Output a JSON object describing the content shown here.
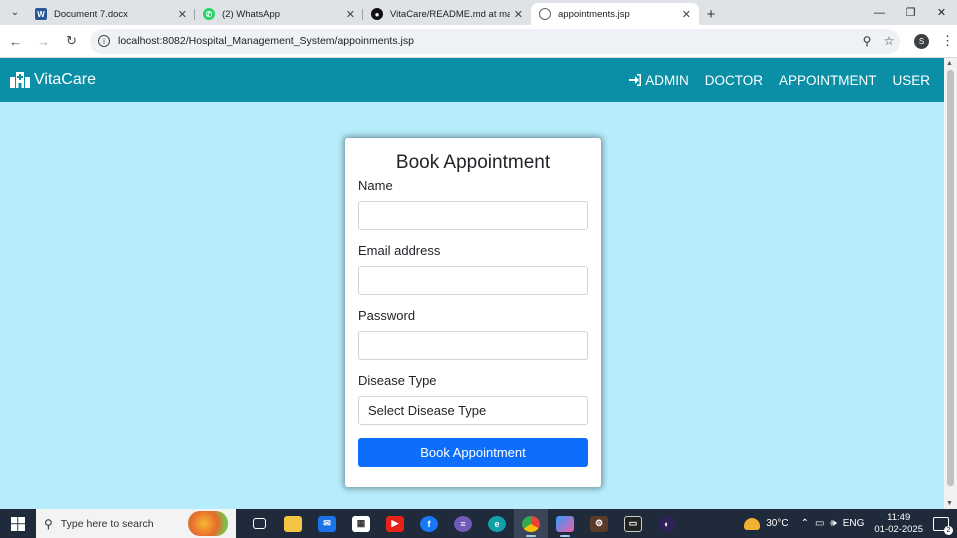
{
  "browser": {
    "tabs": [
      {
        "title": "Document 7.docx",
        "icon": "word-icon",
        "color": "#2b579a",
        "glyph": "W"
      },
      {
        "title": "(2) WhatsApp",
        "icon": "whatsapp-icon",
        "color": "#25d366",
        "glyph": ""
      },
      {
        "title": "VitaCare/README.md at main ·",
        "icon": "github-icon",
        "color": "#111111",
        "glyph": ""
      },
      {
        "title": "appointments.jsp",
        "icon": "globe-icon",
        "color": "#5f6368",
        "glyph": ""
      }
    ],
    "url": "localhost:8082/Hospital_Management_System/appoinments.jsp",
    "profile_initial": "S"
  },
  "navbar": {
    "brand": "VitaCare",
    "links": [
      "ADMIN",
      "DOCTOR",
      "APPOINTMENT",
      "USER"
    ],
    "bg_color": "#0b8fa6"
  },
  "form": {
    "title": "Book Appointment",
    "name_label": "Name",
    "email_label": "Email address",
    "password_label": "Password",
    "disease_label": "Disease Type",
    "disease_selected": "Select Disease Type",
    "submit_label": "Book Appointment"
  },
  "taskbar": {
    "search_placeholder": "Type here to search",
    "temperature": "30°C",
    "language": "ENG",
    "time": "11:49",
    "date": "01-02-2025",
    "notification_count": "2"
  }
}
